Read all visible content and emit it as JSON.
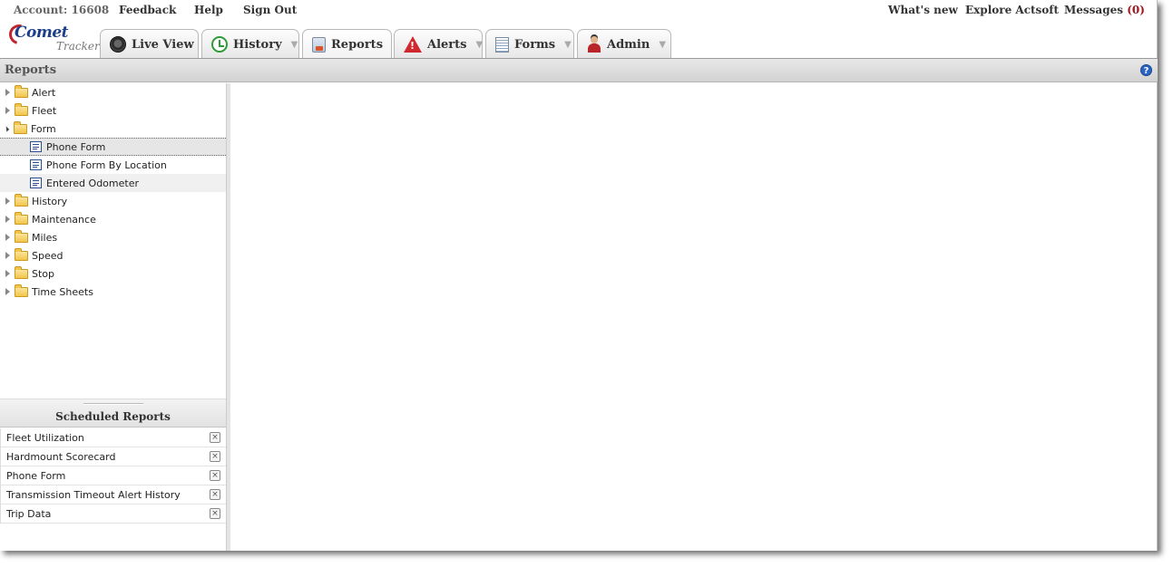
{
  "topbar": {
    "account": "Account: 16608",
    "feedback": "Feedback",
    "help": "Help",
    "signout": "Sign Out",
    "whats_new": "What's new",
    "explore": "Explore Actsoft",
    "messages_label": "Messages",
    "messages_count": "(0)"
  },
  "logo": {
    "brand": "Comet",
    "sub": "Tracker"
  },
  "tabs": [
    {
      "label": "Live View",
      "icon": "live-view-icon"
    },
    {
      "label": "History",
      "icon": "history-clock-icon"
    },
    {
      "label": "Reports",
      "icon": "reports-icon"
    },
    {
      "label": "Alerts",
      "icon": "alert-triangle-icon"
    },
    {
      "label": "Forms",
      "icon": "forms-icon"
    },
    {
      "label": "Admin",
      "icon": "admin-user-icon"
    }
  ],
  "strip": {
    "title": "Reports",
    "help_icon": "?"
  },
  "tree": {
    "folders": [
      "Alert",
      "Fleet",
      "Form",
      "History",
      "Maintenance",
      "Miles",
      "Speed",
      "Stop",
      "Time Sheets"
    ],
    "form_children": [
      "Phone Form",
      "Phone Form By Location",
      "Entered Odometer"
    ]
  },
  "scheduled": {
    "title": "Scheduled Reports",
    "items": [
      "Fleet Utilization",
      "Hardmount Scorecard",
      "Phone Form",
      "Transmission Timeout Alert History",
      "Trip Data"
    ],
    "remove_glyph": "×"
  },
  "colors": {
    "accent_blue": "#1d3f8a",
    "logo_red": "#c0262d",
    "messages_red": "#a0171c"
  }
}
